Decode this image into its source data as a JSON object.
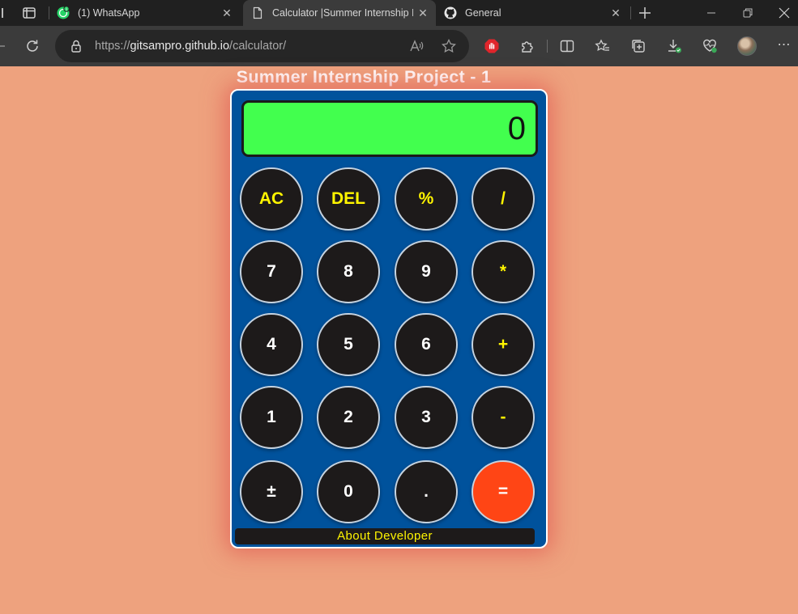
{
  "browser": {
    "tabs": [
      {
        "title": "(1) WhatsApp",
        "icon": "whatsapp-icon"
      },
      {
        "title": "Calculator |Summer Internship Pr",
        "icon": "page-icon",
        "active": true
      },
      {
        "title": "General",
        "icon": "github-icon"
      }
    ],
    "address": {
      "scheme": "https://",
      "host": "gitsampro.github.io",
      "path": "/calculator/"
    }
  },
  "page": {
    "title": "Summer Internship Project - 1"
  },
  "calculator": {
    "display": "0",
    "keys": [
      [
        "AC",
        "DEL",
        "%",
        "/"
      ],
      [
        "7",
        "8",
        "9",
        "*"
      ],
      [
        "4",
        "5",
        "6",
        "+"
      ],
      [
        "1",
        "2",
        "3",
        "-"
      ],
      [
        "±",
        "0",
        ".",
        "="
      ]
    ],
    "about_label": "About Developer"
  },
  "colors": {
    "background": "#eea27e",
    "calculator_body": "#00529c",
    "display": "#42ff4e",
    "key": "#1d1a1a",
    "operator_text": "#fff500",
    "equals": "#ff4515"
  }
}
